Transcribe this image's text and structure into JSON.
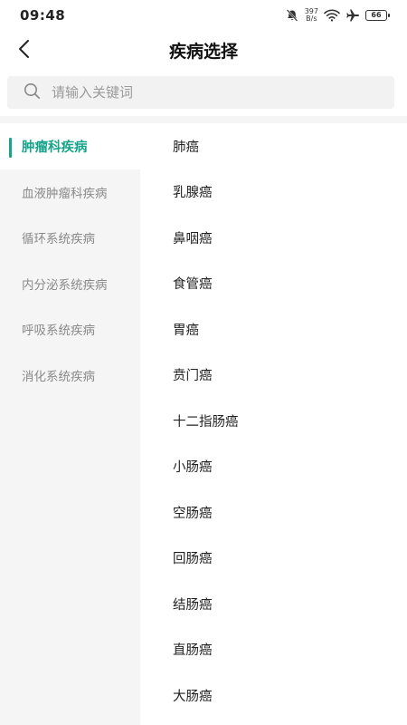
{
  "status": {
    "time": "09:48",
    "net_speed_value": "397",
    "net_speed_unit": "B/s",
    "battery": "66"
  },
  "nav": {
    "title": "疾病选择"
  },
  "search": {
    "placeholder": "请输入关键词",
    "value": ""
  },
  "categories": [
    {
      "label": "肿瘤科疾病",
      "active": true
    },
    {
      "label": "血液肿瘤科疾病"
    },
    {
      "label": "循环系统疾病"
    },
    {
      "label": "内分泌系统疾病"
    },
    {
      "label": "呼吸系统疾病"
    },
    {
      "label": "消化系统疾病"
    }
  ],
  "diseases": [
    "肺癌",
    "乳腺癌",
    "鼻咽癌",
    "食管癌",
    "胃癌",
    "贲门癌",
    "十二指肠癌",
    "小肠癌",
    "空肠癌",
    "回肠癌",
    "结肠癌",
    "直肠癌",
    "大肠癌"
  ],
  "colors": {
    "accent": "#17a48a",
    "sidebar_bg": "#f5f5f5",
    "search_bg": "#f2f2f2"
  },
  "icons": [
    "bell-muted-icon",
    "wifi-icon",
    "airplane-icon",
    "battery-icon",
    "back-arrow-icon",
    "search-icon"
  ]
}
